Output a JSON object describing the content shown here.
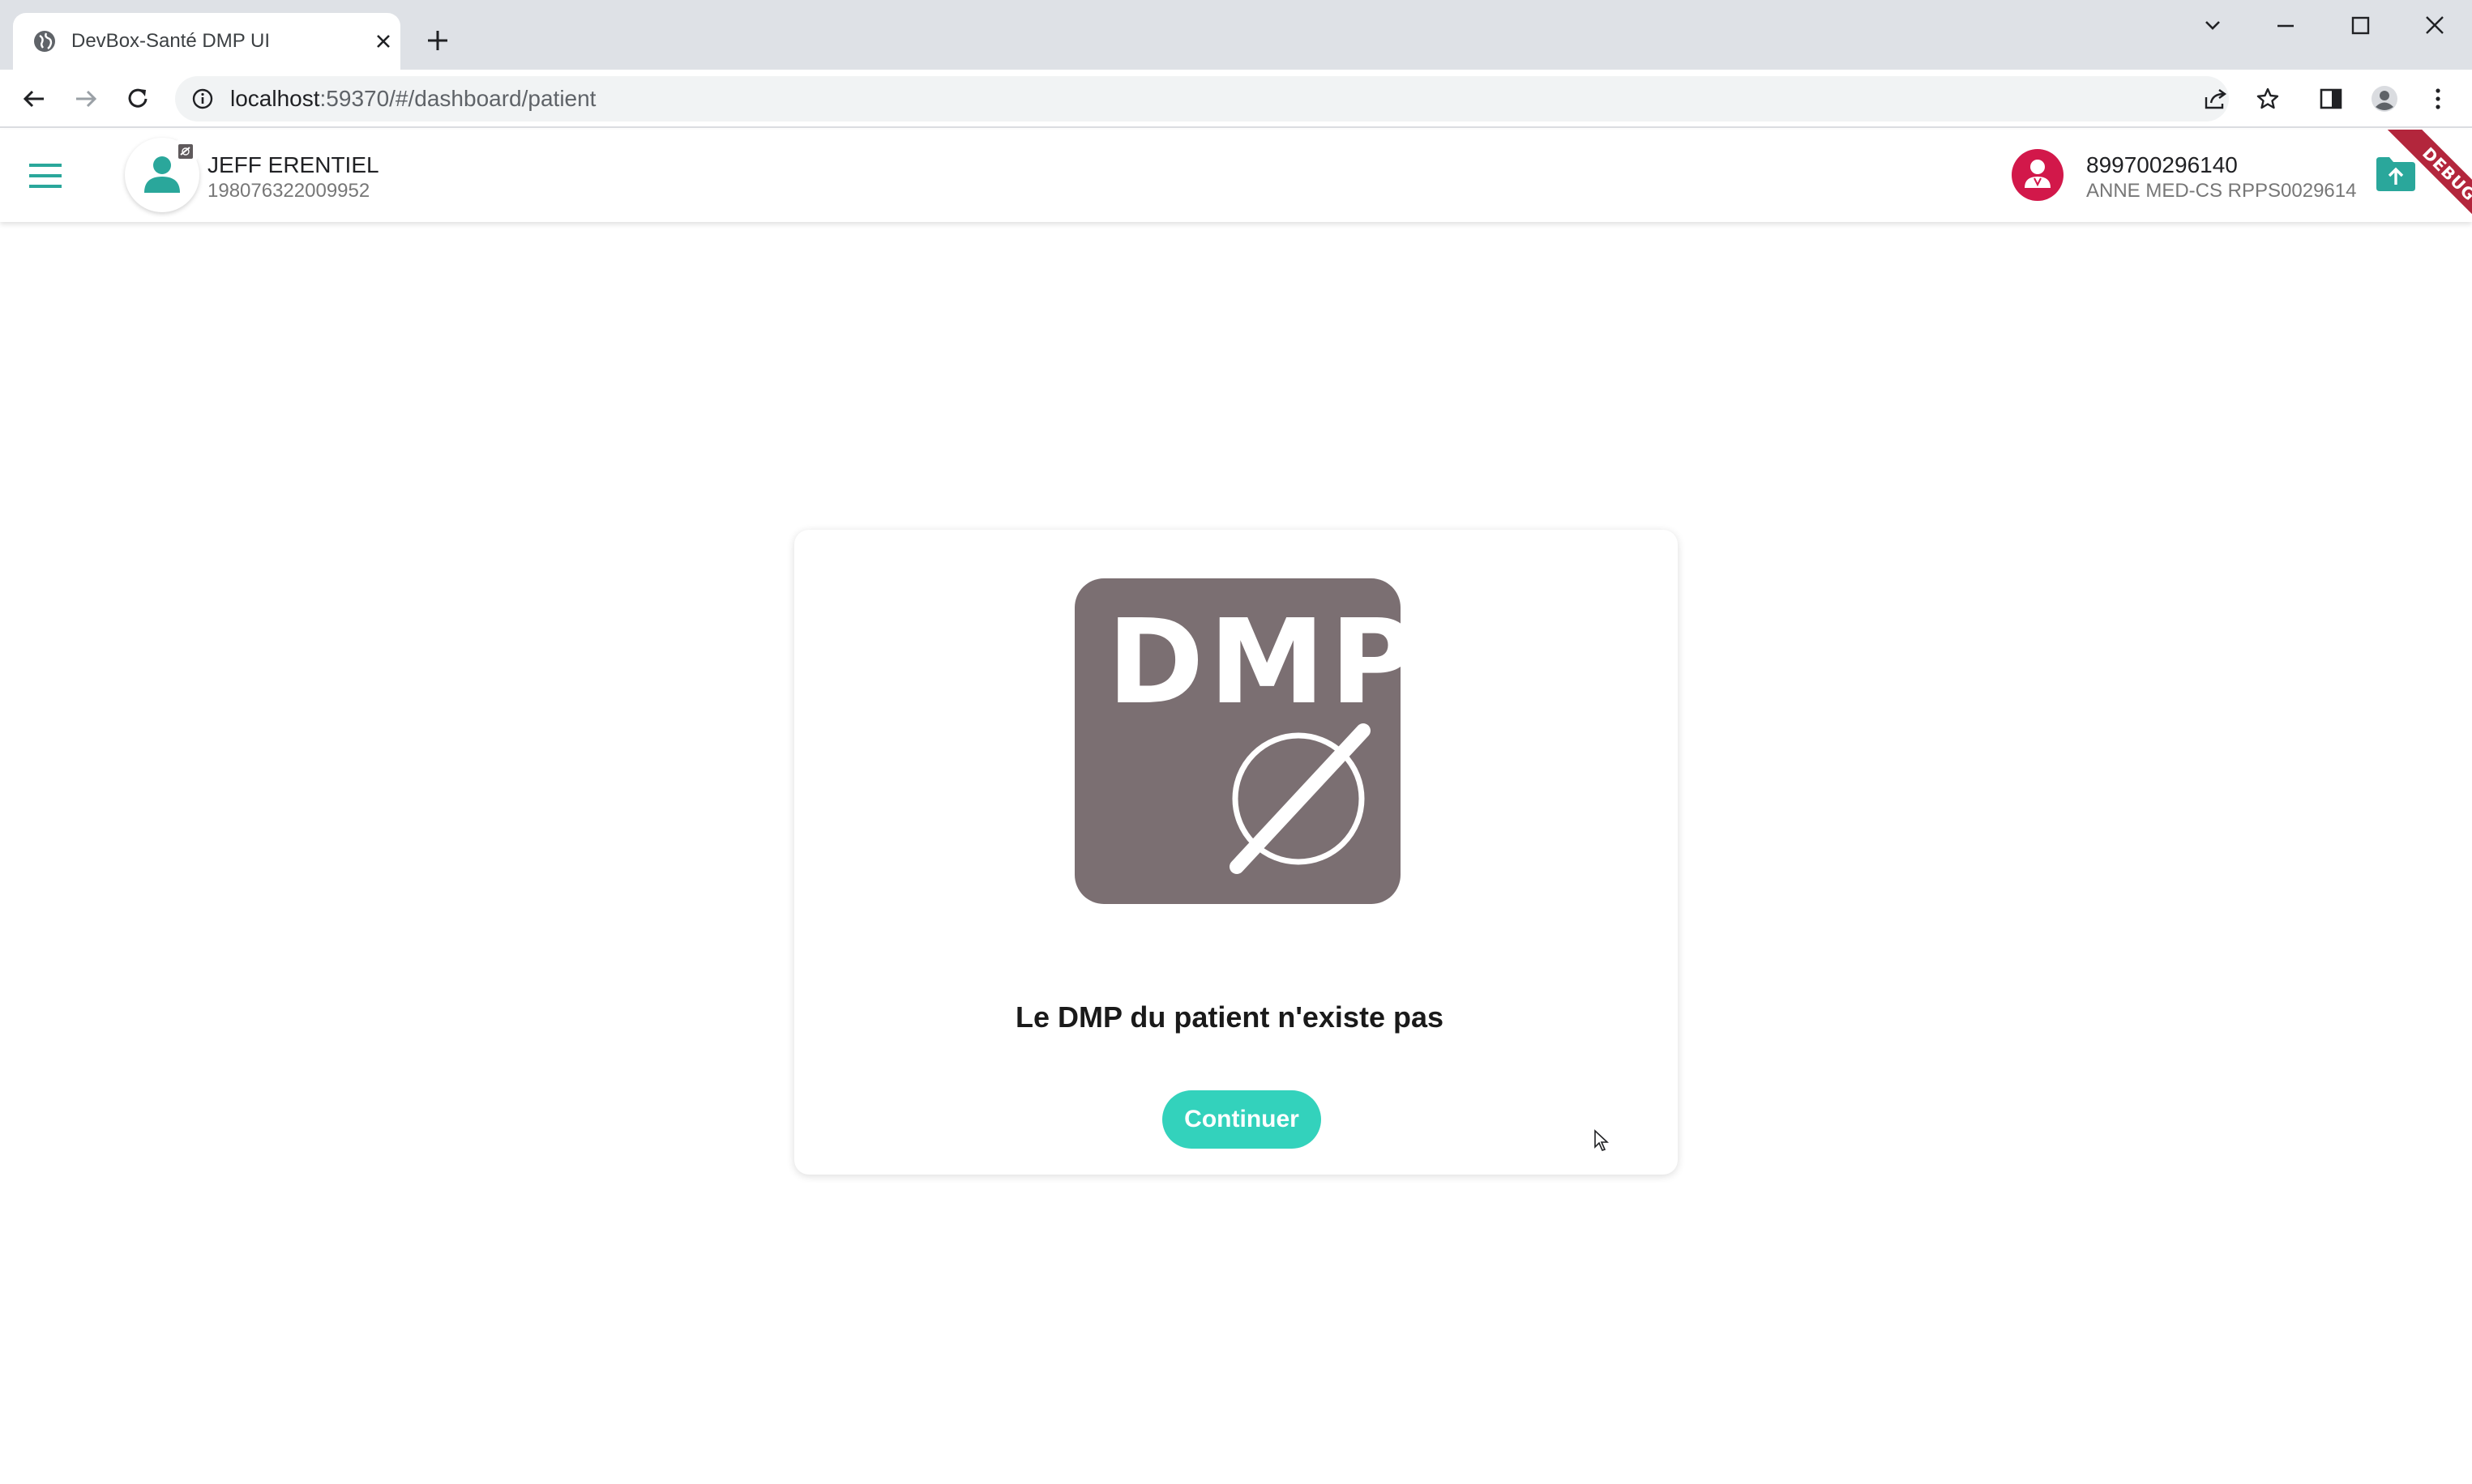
{
  "browser": {
    "tab_title": "DevBox-Santé DMP UI",
    "url_host": "localhost",
    "url_rest": ":59370/#/dashboard/patient",
    "icons": [
      "globe-icon",
      "close-icon",
      "plus-icon",
      "chevron-down-icon",
      "minimize-icon",
      "maximize-icon",
      "close-window-icon",
      "back-icon",
      "forward-icon",
      "reload-icon",
      "info-icon",
      "share-icon",
      "star-icon",
      "side-panel-icon",
      "profile-icon",
      "more-icon"
    ]
  },
  "header": {
    "patient_name": "JEFF ERENTIEL",
    "patient_id": "198076322009952",
    "ps_number": "899700296140",
    "ps_name": "ANNE MED-CS RPPS0029614",
    "debug_label": "DEBUG",
    "accent_color": "#2aa79b",
    "ps_avatar_color": "#d2184a"
  },
  "dialog": {
    "logo_text": "DMP",
    "message": "Le DMP du patient n'existe pas",
    "continue_label": "Continuer",
    "button_color": "#33d2bc",
    "logo_color": "#7b6f72"
  }
}
